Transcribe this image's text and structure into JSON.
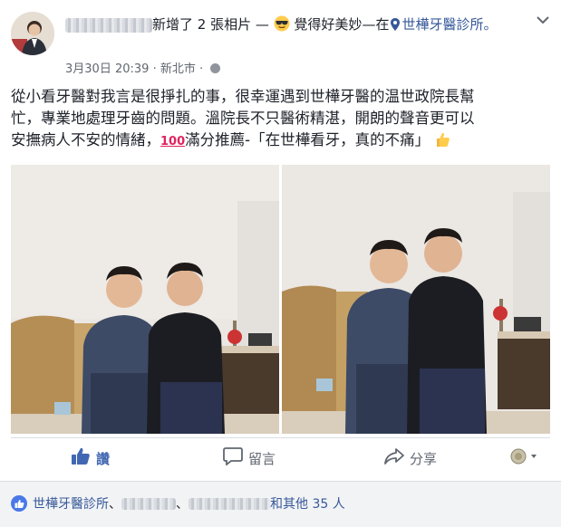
{
  "post": {
    "author_redacted": true,
    "action_text": "新增了 2 張相片 —",
    "feeling_text": "覺得好美妙",
    "at_text": "—在",
    "place": "世樺牙醫診所。",
    "date": "3月30日 20:39",
    "separator": "·",
    "location": "新北市",
    "sep2": "·",
    "body_line1": "從小看牙醫對我言是很掙扎的事，很幸運遇到世樺牙醫的温世政院長幫",
    "body_line2": "忙，專業地處理牙齒的問題。溫院長不只醫術精湛，開朗的聲音更可以",
    "body_line3": "安撫病人不安的情緒，",
    "hundred": "100",
    "body_line3b": "滿分推薦-「在世樺看牙，真的不痛」"
  },
  "actions": {
    "like": "讚",
    "comment": "留言",
    "share": "分享"
  },
  "reactions": {
    "first": "世樺牙醫診所",
    "sep1": "、",
    "sep2": "、",
    "tail": "和其他 35 人"
  },
  "colors": {
    "link": "#365899",
    "like_blue": "#4267b2",
    "muted": "#606770"
  },
  "icons": [
    "more-icon",
    "sunglasses-emoji-icon",
    "location-pin-icon",
    "globe-icon",
    "thumbs-up-emoji-icon",
    "like-icon",
    "comment-icon",
    "share-icon",
    "reaction-selector-icon"
  ]
}
